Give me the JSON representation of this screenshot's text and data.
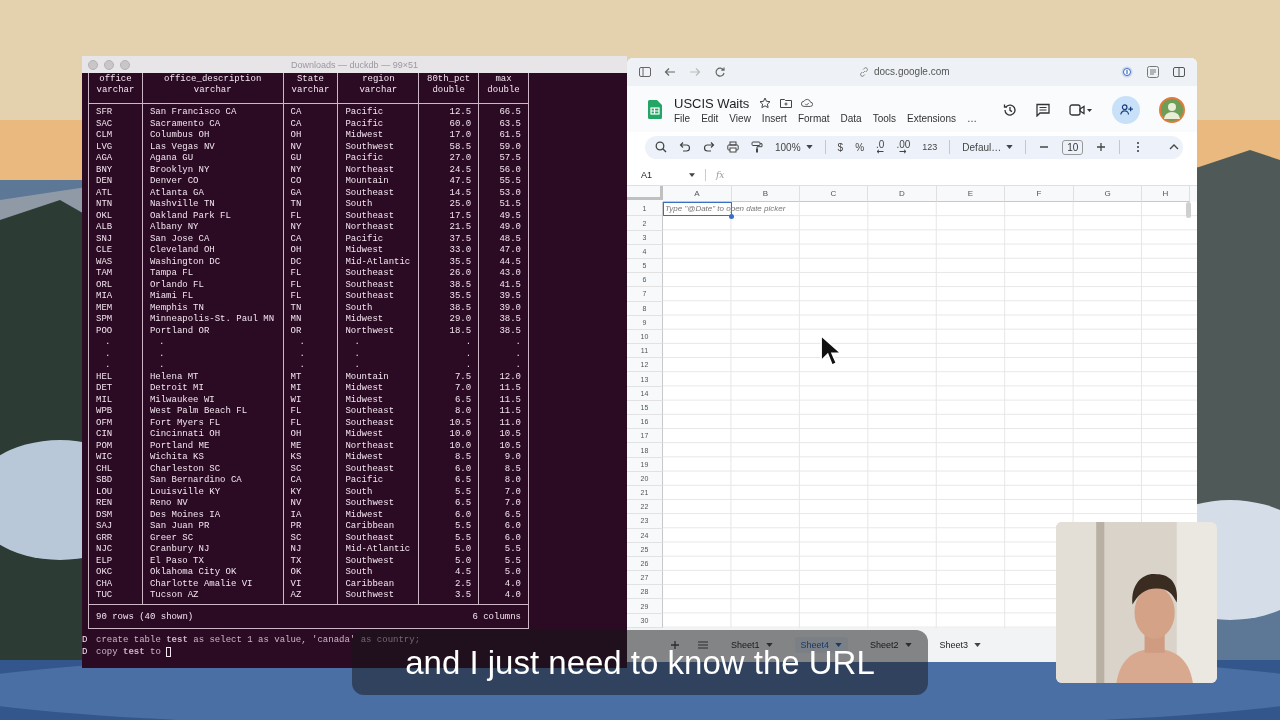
{
  "terminal": {
    "title": "Downloads — duckdb — 99×51",
    "columns": [
      {
        "name": "office",
        "type": "varchar"
      },
      {
        "name": "office_description",
        "type": "varchar"
      },
      {
        "name": "State",
        "type": "varchar"
      },
      {
        "name": "region",
        "type": "varchar"
      },
      {
        "name": "80th_pct",
        "type": "double"
      },
      {
        "name": "max",
        "type": "double"
      }
    ],
    "rows": [
      [
        "SFR",
        "San Francisco CA",
        "CA",
        "Pacific",
        "12.5",
        "66.5"
      ],
      [
        "SAC",
        "Sacramento CA",
        "CA",
        "Pacific",
        "60.0",
        "63.5"
      ],
      [
        "CLM",
        "Columbus OH",
        "OH",
        "Midwest",
        "17.0",
        "61.5"
      ],
      [
        "LVG",
        "Las Vegas NV",
        "NV",
        "Southwest",
        "58.5",
        "59.0"
      ],
      [
        "AGA",
        "Agana GU",
        "GU",
        "Pacific",
        "27.0",
        "57.5"
      ],
      [
        "BNY",
        "Brooklyn NY",
        "NY",
        "Northeast",
        "24.5",
        "56.0"
      ],
      [
        "DEN",
        "Denver CO",
        "CO",
        "Mountain",
        "47.5",
        "55.5"
      ],
      [
        "ATL",
        "Atlanta GA",
        "GA",
        "Southeast",
        "14.5",
        "53.0"
      ],
      [
        "NTN",
        "Nashville TN",
        "TN",
        "South",
        "25.0",
        "51.5"
      ],
      [
        "OKL",
        "Oakland Park FL",
        "FL",
        "Southeast",
        "17.5",
        "49.5"
      ],
      [
        "ALB",
        "Albany NY",
        "NY",
        "Northeast",
        "21.5",
        "49.0"
      ],
      [
        "SNJ",
        "San Jose CA",
        "CA",
        "Pacific",
        "37.5",
        "48.5"
      ],
      [
        "CLE",
        "Cleveland OH",
        "OH",
        "Midwest",
        "33.0",
        "47.0"
      ],
      [
        "WAS",
        "Washington DC",
        "DC",
        "Mid-Atlantic",
        "35.5",
        "44.5"
      ],
      [
        "TAM",
        "Tampa FL",
        "FL",
        "Southeast",
        "26.0",
        "43.0"
      ],
      [
        "ORL",
        "Orlando FL",
        "FL",
        "Southeast",
        "38.5",
        "41.5"
      ],
      [
        "MIA",
        "Miami FL",
        "FL",
        "Southeast",
        "35.5",
        "39.5"
      ],
      [
        "MEM",
        "Memphis TN",
        "TN",
        "South",
        "38.5",
        "39.0"
      ],
      [
        "SPM",
        "Minneapolis-St. Paul MN",
        "MN",
        "Midwest",
        "29.0",
        "38.5"
      ],
      [
        "POO",
        "Portland OR",
        "OR",
        "Northwest",
        "18.5",
        "38.5"
      ],
      [
        ".",
        ".",
        ".",
        ".",
        ".",
        "."
      ],
      [
        ".",
        ".",
        ".",
        ".",
        ".",
        "."
      ],
      [
        ".",
        ".",
        ".",
        ".",
        ".",
        "."
      ],
      [
        "HEL",
        "Helena MT",
        "MT",
        "Mountain",
        "7.5",
        "12.0"
      ],
      [
        "DET",
        "Detroit MI",
        "MI",
        "Midwest",
        "7.0",
        "11.5"
      ],
      [
        "MIL",
        "Milwaukee WI",
        "WI",
        "Midwest",
        "6.5",
        "11.5"
      ],
      [
        "WPB",
        "West Palm Beach FL",
        "FL",
        "Southeast",
        "8.0",
        "11.5"
      ],
      [
        "OFM",
        "Fort Myers FL",
        "FL",
        "Southeast",
        "10.5",
        "11.0"
      ],
      [
        "CIN",
        "Cincinnati OH",
        "OH",
        "Midwest",
        "10.0",
        "10.5"
      ],
      [
        "POM",
        "Portland ME",
        "ME",
        "Northeast",
        "10.0",
        "10.5"
      ],
      [
        "WIC",
        "Wichita KS",
        "KS",
        "Midwest",
        "8.5",
        "9.0"
      ],
      [
        "CHL",
        "Charleston SC",
        "SC",
        "Southeast",
        "6.0",
        "8.5"
      ],
      [
        "SBD",
        "San Bernardino CA",
        "CA",
        "Pacific",
        "6.5",
        "8.0"
      ],
      [
        "LOU",
        "Louisville KY",
        "KY",
        "South",
        "5.5",
        "7.0"
      ],
      [
        "REN",
        "Reno NV",
        "NV",
        "Southwest",
        "6.5",
        "7.0"
      ],
      [
        "DSM",
        "Des Moines IA",
        "IA",
        "Midwest",
        "6.0",
        "6.5"
      ],
      [
        "SAJ",
        "San Juan PR",
        "PR",
        "Caribbean",
        "5.5",
        "6.0"
      ],
      [
        "GRR",
        "Greer SC",
        "SC",
        "Southeast",
        "5.5",
        "6.0"
      ],
      [
        "NJC",
        "Cranbury NJ",
        "NJ",
        "Mid-Atlantic",
        "5.0",
        "5.5"
      ],
      [
        "ELP",
        "El Paso TX",
        "TX",
        "Southwest",
        "5.0",
        "5.5"
      ],
      [
        "OKC",
        "Oklahoma City OK",
        "OK",
        "South",
        "4.5",
        "5.0"
      ],
      [
        "CHA",
        "Charlotte Amalie VI",
        "VI",
        "Caribbean",
        "2.5",
        "4.0"
      ],
      [
        "TUC",
        "Tucson AZ",
        "AZ",
        "Southwest",
        "3.5",
        "4.0"
      ]
    ],
    "footer": {
      "rows": "90 rows (40 shown)",
      "columns": "6 columns"
    },
    "history": [
      {
        "prompt": "D",
        "command": "create table **test** as select 1 as value, 'canada' as country;",
        "cursor": false
      },
      {
        "prompt": "D",
        "command": "copy **test** to",
        "cursor": true
      }
    ]
  },
  "sheets": {
    "url": "docs.google.com",
    "title": "USCIS Waits",
    "menu": [
      "File",
      "Edit",
      "View",
      "Insert",
      "Format",
      "Data",
      "Tools",
      "Extensions",
      "…"
    ],
    "toolbar": {
      "zoom": "100%",
      "currency": "$",
      "percent": "%",
      "decrease_decimal": ".0",
      "increase_decimal": ".00",
      "number_format": "123",
      "font": "Defaul…",
      "font_size": "10"
    },
    "formula_bar": {
      "cell": "A1",
      "fx": "fx"
    },
    "column_headers": [
      "A",
      "B",
      "C",
      "D",
      "E",
      "F",
      "G",
      "H"
    ],
    "row_numbers": [
      "1",
      "2",
      "3",
      "4",
      "5",
      "6",
      "7",
      "8",
      "9",
      "10",
      "11",
      "12",
      "13",
      "14",
      "15",
      "16",
      "17",
      "18",
      "19",
      "20",
      "21",
      "22",
      "23",
      "24",
      "25",
      "26",
      "27",
      "28",
      "29",
      "30"
    ],
    "cell_hint": "Type \"@Date\" to open date picker",
    "tabs": [
      {
        "label": "Sheet1",
        "selected": false
      },
      {
        "label": "Sheet4",
        "selected": true
      },
      {
        "label": "Sheet2",
        "selected": false
      },
      {
        "label": "Sheet3",
        "selected": false
      }
    ]
  },
  "subtitle": "and I just need to know the URL"
}
